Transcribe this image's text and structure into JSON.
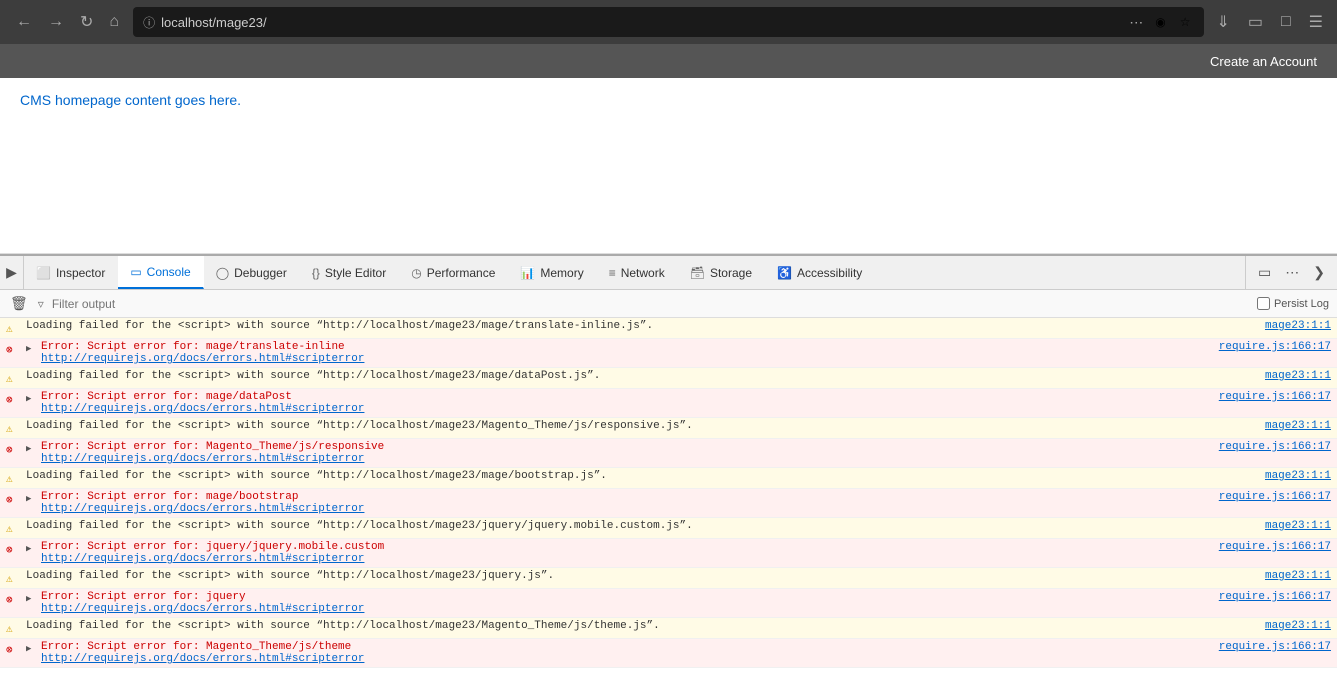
{
  "browser": {
    "url": "localhost/mage23/",
    "create_account": "Create an Account",
    "cms_text": "CMS homepage content goes here."
  },
  "devtools": {
    "tabs": [
      {
        "id": "inspector",
        "label": "Inspector",
        "icon": "⬜"
      },
      {
        "id": "console",
        "label": "Console",
        "icon": "▭",
        "active": true
      },
      {
        "id": "debugger",
        "label": "Debugger",
        "icon": "◯"
      },
      {
        "id": "style-editor",
        "label": "Style Editor",
        "icon": "{}"
      },
      {
        "id": "performance",
        "label": "Performance",
        "icon": "◷"
      },
      {
        "id": "memory",
        "label": "Memory",
        "icon": "📊"
      },
      {
        "id": "network",
        "label": "Network",
        "icon": "≡"
      },
      {
        "id": "storage",
        "label": "Storage",
        "icon": "🗃"
      },
      {
        "id": "accessibility",
        "label": "Accessibility",
        "icon": "♿"
      }
    ]
  },
  "console": {
    "filter_placeholder": "Filter output",
    "persist_log_label": "Persist Log",
    "rows": [
      {
        "type": "warning",
        "message": "Loading failed for the <script> with source “http://localhost/mage23/mage/translate-inline.js”.",
        "source": "mage23:1:1"
      },
      {
        "type": "error",
        "expandable": true,
        "message": "Error: Script error for: mage/translate-inline",
        "link": "http://requirejs.org/docs/errors.html#scripterror",
        "source": "require.js:166:17"
      },
      {
        "type": "warning",
        "message": "Loading failed for the <script> with source “http://localhost/mage23/mage/dataPost.js”.",
        "source": "mage23:1:1"
      },
      {
        "type": "error",
        "expandable": true,
        "message": "Error: Script error for: mage/dataPost",
        "link": "http://requirejs.org/docs/errors.html#scripterror",
        "source": "require.js:166:17"
      },
      {
        "type": "warning",
        "message": "Loading failed for the <script> with source “http://localhost/mage23/Magento_Theme/js/responsive.js”.",
        "source": "mage23:1:1"
      },
      {
        "type": "error",
        "expandable": true,
        "message": "Error: Script error for: Magento_Theme/js/responsive",
        "link": "http://requirejs.org/docs/errors.html#scripterror",
        "source": "require.js:166:17"
      },
      {
        "type": "warning",
        "message": "Loading failed for the <script> with source “http://localhost/mage23/mage/bootstrap.js”.",
        "source": "mage23:1:1"
      },
      {
        "type": "error",
        "expandable": true,
        "message": "Error: Script error for: mage/bootstrap",
        "link": "http://requirejs.org/docs/errors.html#scripterror",
        "source": "require.js:166:17"
      },
      {
        "type": "warning",
        "message": "Loading failed for the <script> with source “http://localhost/mage23/jquery/jquery.mobile.custom.js”.",
        "source": "mage23:1:1"
      },
      {
        "type": "error",
        "expandable": true,
        "message": "Error: Script error for: jquery/jquery.mobile.custom",
        "link": "http://requirejs.org/docs/errors.html#scripterror",
        "source": "require.js:166:17"
      },
      {
        "type": "warning",
        "message": "Loading failed for the <script> with source “http://localhost/mage23/jquery.js”.",
        "source": "mage23:1:1"
      },
      {
        "type": "error",
        "expandable": true,
        "message": "Error: Script error for: jquery",
        "link": "http://requirejs.org/docs/errors.html#scripterror",
        "source": "require.js:166:17"
      },
      {
        "type": "warning",
        "message": "Loading failed for the <script> with source “http://localhost/mage23/Magento_Theme/js/theme.js”.",
        "source": "mage23:1:1"
      },
      {
        "type": "error",
        "expandable": true,
        "message": "Error: Script error for: Magento_Theme/js/theme",
        "link": "http://requirejs.org/docs/errors.html#scripterror",
        "source": "require.js:166:17"
      }
    ]
  }
}
